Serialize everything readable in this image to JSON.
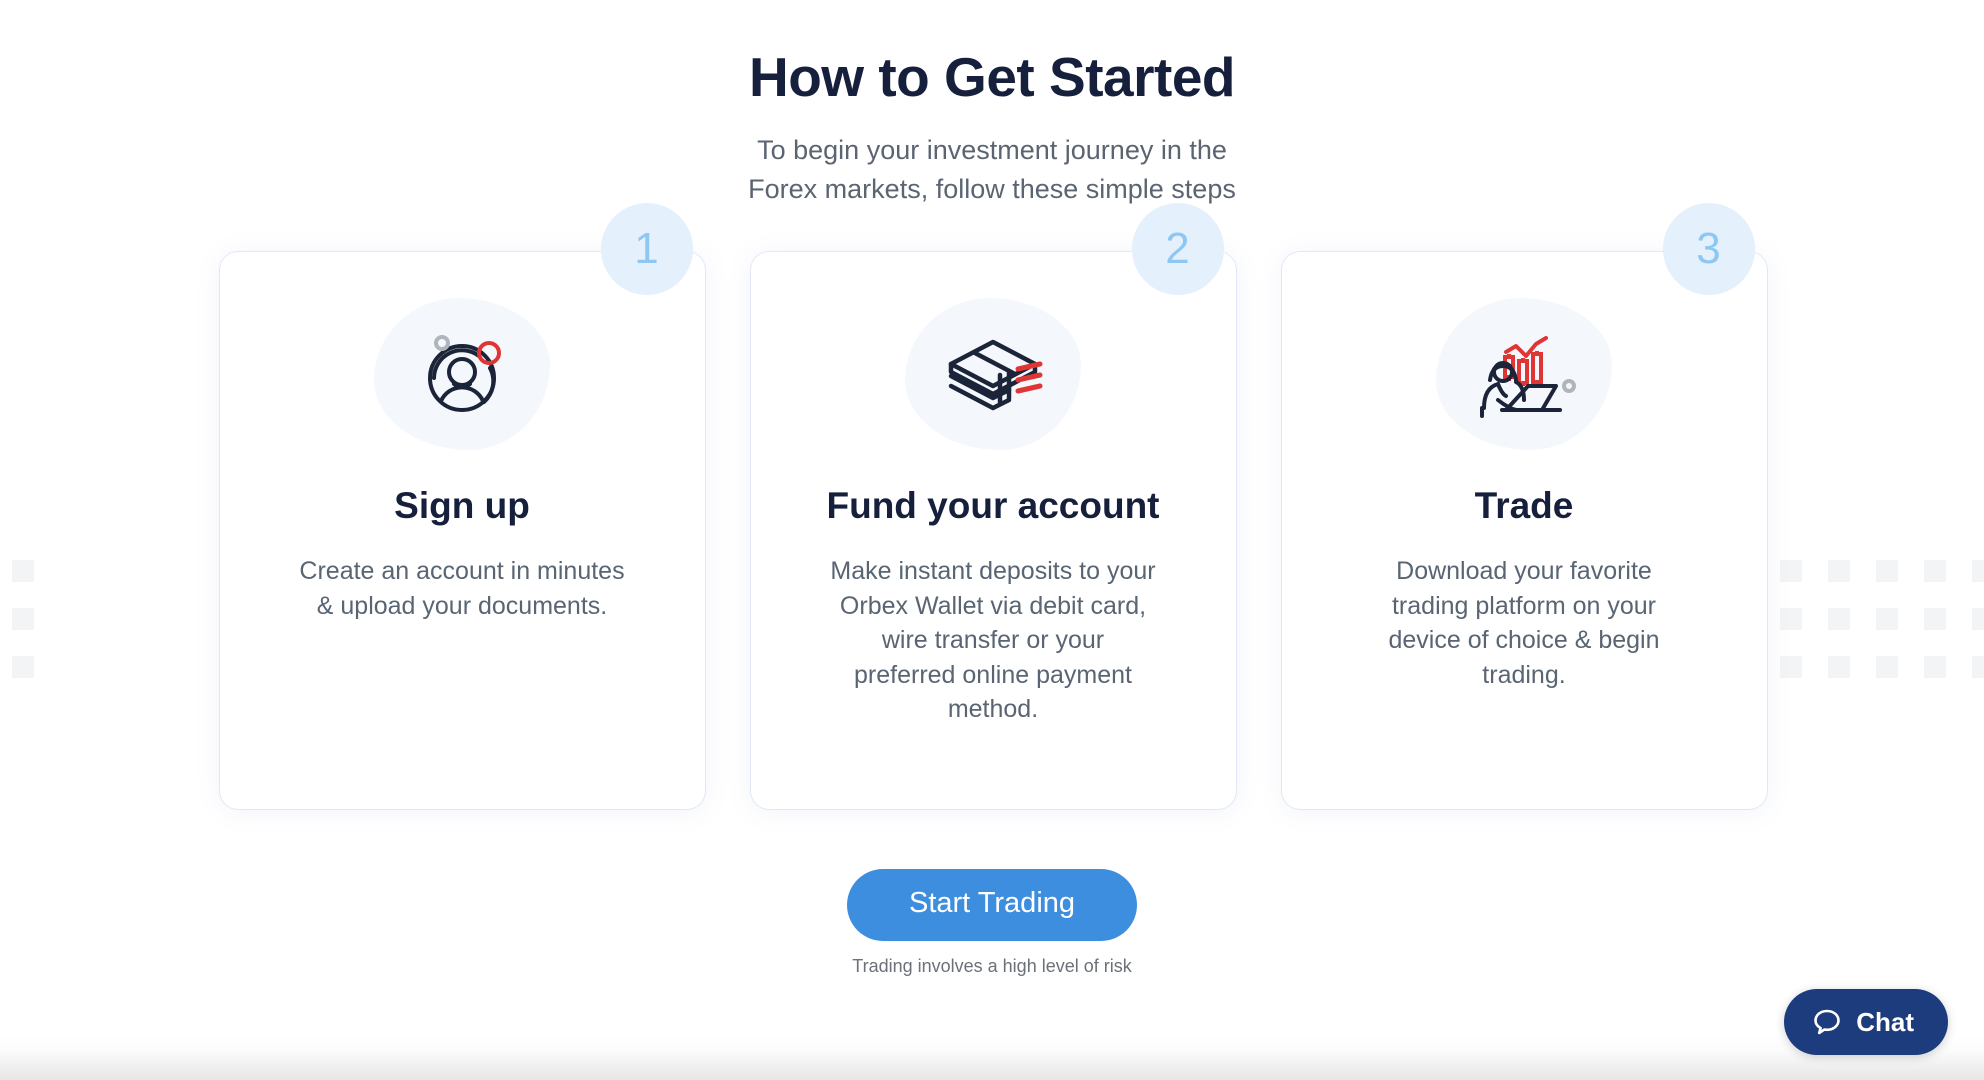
{
  "header": {
    "title": "How to Get Started",
    "subtitle_line1": "To begin your investment journey in the",
    "subtitle_line2": "Forex markets, follow these simple steps"
  },
  "steps": [
    {
      "number": "1",
      "icon": "user-avatar-icon",
      "title": "Sign up",
      "text_line1": "Create an account in minutes",
      "text_line2": "& upload your documents.",
      "text_line3": "",
      "text_line4": "",
      "text_line5": ""
    },
    {
      "number": "2",
      "icon": "cash-stack-icon",
      "title": "Fund your account",
      "text_line1": "Make instant deposits to your",
      "text_line2": "Orbex Wallet via debit card,",
      "text_line3": "wire transfer or your",
      "text_line4": "preferred online payment",
      "text_line5": "method."
    },
    {
      "number": "3",
      "icon": "trader-laptop-chart-icon",
      "title": "Trade",
      "text_line1": "Download your favorite",
      "text_line2": "trading platform on your",
      "text_line3": "device of choice & begin",
      "text_line4": "trading.",
      "text_line5": ""
    }
  ],
  "cta": {
    "button_label": "Start Trading",
    "note": "Trading involves a high level of risk"
  },
  "chat": {
    "label": "Chat",
    "icon": "speech-bubble-icon"
  },
  "colors": {
    "heading": "#16203c",
    "body_text": "#596573",
    "badge_bg": "#e4f0fb",
    "badge_text": "#8ec8f2",
    "cta_blue": "#3e8ee0",
    "chat_navy": "#1d3c7d",
    "icon_navy": "#1b2438",
    "icon_red": "#e03535",
    "blob_bg": "#f4f8fc",
    "dot_gray": "#f3f4f5"
  }
}
